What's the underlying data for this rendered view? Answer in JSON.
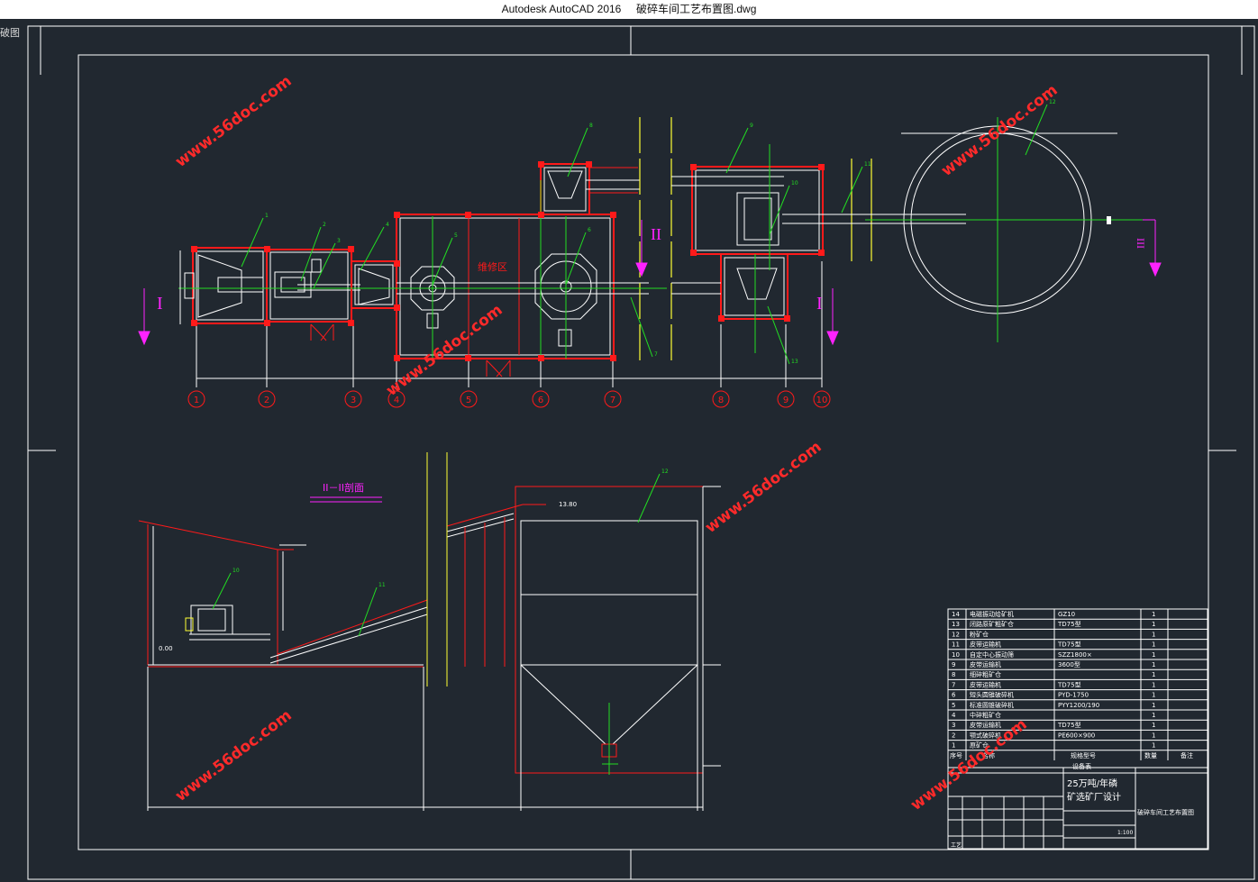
{
  "window": {
    "app_title": "Autodesk AutoCAD 2016",
    "file_name": "破碎车间工艺布置图.dwg",
    "side_tab": "破图"
  },
  "colors": {
    "background": "#212830",
    "white": "#ffffff",
    "red": "#ff1a1a",
    "green": "#22dd22",
    "yellow": "#ffff33",
    "magenta": "#ff22ff",
    "watermark": "#ff2a2a"
  },
  "watermark": "www.56doc.com",
  "plan": {
    "maintenance_area": "维修区",
    "section_mark_I": "I",
    "section_mark_II": "II",
    "section_mark_III": "III",
    "axis_labels": [
      "1",
      "2",
      "3",
      "4",
      "5",
      "6",
      "7",
      "8",
      "9",
      "10"
    ],
    "callouts": [
      "1",
      "2",
      "3",
      "4",
      "5",
      "6",
      "7",
      "8",
      "9",
      "10",
      "11",
      "12",
      "13"
    ]
  },
  "section": {
    "title": "II－II剖面",
    "elevation_top": "13.80",
    "elevation_base": "0.00",
    "callouts": [
      "10",
      "11",
      "12"
    ]
  },
  "equipment_table": {
    "rows": [
      {
        "no": "14",
        "name": "电磁振动给矿机",
        "model": "GZ10",
        "qty": "1"
      },
      {
        "no": "13",
        "name": "闭路原矿粗矿仓",
        "model": "TD75型",
        "qty": "1"
      },
      {
        "no": "12",
        "name": "粉矿仓",
        "model": "",
        "qty": "1"
      },
      {
        "no": "11",
        "name": "皮带运输机",
        "model": "TD75型",
        "qty": "1"
      },
      {
        "no": "10",
        "name": "自定中心振动筛",
        "model": "SZZ1800×",
        "qty": "1"
      },
      {
        "no": "9",
        "name": "皮带运输机",
        "model": "3600型",
        "qty": "1"
      },
      {
        "no": "8",
        "name": "细碎粗矿仓",
        "model": "",
        "qty": "1"
      },
      {
        "no": "7",
        "name": "皮带运输机",
        "model": "TD75型",
        "qty": "1"
      },
      {
        "no": "6",
        "name": "短头圆锥破碎机",
        "model": "PYD-1750",
        "qty": "1"
      },
      {
        "no": "5",
        "name": "标准圆锥破碎机",
        "model": "PYY1200/190",
        "qty": "1"
      },
      {
        "no": "4",
        "name": "中碎粗矿仓",
        "model": "",
        "qty": "1"
      },
      {
        "no": "3",
        "name": "皮带运输机",
        "model": "TD75型",
        "qty": "1"
      },
      {
        "no": "2",
        "name": "颚式破碎机",
        "model": "PE600×900",
        "qty": "1"
      },
      {
        "no": "1",
        "name": "原矿仓",
        "model": "",
        "qty": "1"
      }
    ],
    "header": {
      "no": "序号",
      "name": "名称",
      "model": "规格型号",
      "qty": "数量",
      "remark": "备注"
    },
    "caption": "设备表"
  },
  "title_block": {
    "project_line1": "25万吨/年磷",
    "project_line2": "矿选矿厂设计",
    "drawing_title": "破碎车间工艺布置图",
    "scale": "1:100",
    "stage": "工艺"
  }
}
